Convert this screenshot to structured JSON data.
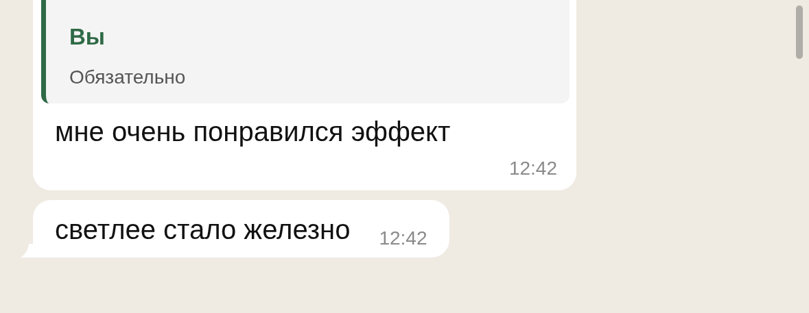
{
  "messages": [
    {
      "quote": {
        "author": "Вы",
        "text": "Обязательно"
      },
      "text": "мне очень понравился эффект",
      "time": "12:42",
      "tail": false
    },
    {
      "text": "светлее стало железно",
      "time": "12:42",
      "tail": true
    }
  ]
}
